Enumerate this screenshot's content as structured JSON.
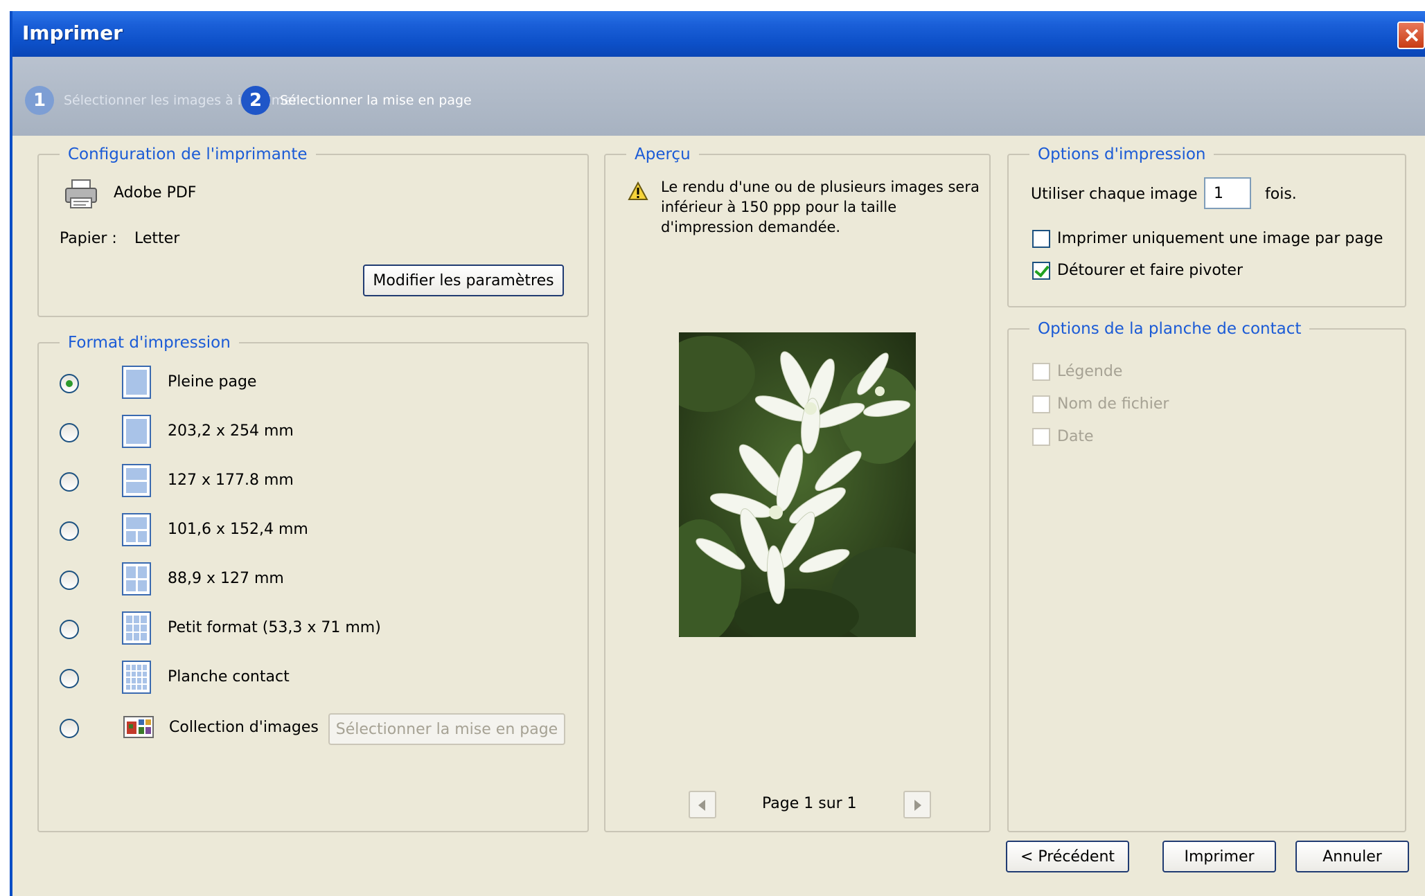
{
  "window": {
    "title": "Imprimer"
  },
  "steps": [
    {
      "number": "1",
      "label": "Sélectionner les images à imprimer"
    },
    {
      "number": "2",
      "label": "Sélectionner la mise en page"
    }
  ],
  "printer_config": {
    "legend": "Configuration de l'imprimante",
    "printer_name": "Adobe PDF",
    "paper_label": "Papier :",
    "paper_value": "Letter",
    "modify_button": "Modifier les paramètres"
  },
  "print_format": {
    "legend": "Format d'impression",
    "options": [
      {
        "label": "Pleine page",
        "selected": true,
        "icon": "full-page-layout-icon"
      },
      {
        "label": "203,2 x 254 mm",
        "selected": false,
        "icon": "single-image-layout-icon"
      },
      {
        "label": "127 x 177.8 mm",
        "selected": false,
        "icon": "two-up-layout-icon"
      },
      {
        "label": "101,6 x 152,4 mm",
        "selected": false,
        "icon": "three-up-layout-icon"
      },
      {
        "label": "88,9 x 127 mm",
        "selected": false,
        "icon": "four-up-layout-icon"
      },
      {
        "label": "Petit format (53,3 x 71 mm)",
        "selected": false,
        "icon": "small-format-grid-icon"
      },
      {
        "label": "Planche contact",
        "selected": false,
        "icon": "contact-sheet-grid-icon"
      },
      {
        "label": "Collection d'images",
        "selected": false,
        "icon": "picture-collection-icon"
      }
    ],
    "layout_button": "Sélectionner la mise en page"
  },
  "preview": {
    "legend": "Aperçu",
    "warning": "Le rendu d'une ou de plusieurs images sera inférieur à 150 ppp pour la taille d'impression demandée.",
    "page_indicator": "Page 1 sur 1"
  },
  "print_options": {
    "legend": "Options d'impression",
    "use_each_label": "Utiliser chaque image",
    "use_each_value": "1",
    "times_label": "fois.",
    "one_per_page_label": "Imprimer uniquement une image par page",
    "one_per_page_checked": false,
    "crop_rotate_label": "Détourer et faire pivoter",
    "crop_rotate_checked": true
  },
  "contact_sheet_options": {
    "legend": "Options de la planche de contact",
    "caption_label": "Légende",
    "filename_label": "Nom de fichier",
    "date_label": "Date"
  },
  "footer": {
    "previous_button": "< Précédent",
    "print_button": "Imprimer",
    "cancel_button": "Annuler"
  },
  "colors": {
    "title_bar": "#0d50c8",
    "legend_text": "#1b5bd6",
    "dialog_bg": "#ece9d8"
  }
}
